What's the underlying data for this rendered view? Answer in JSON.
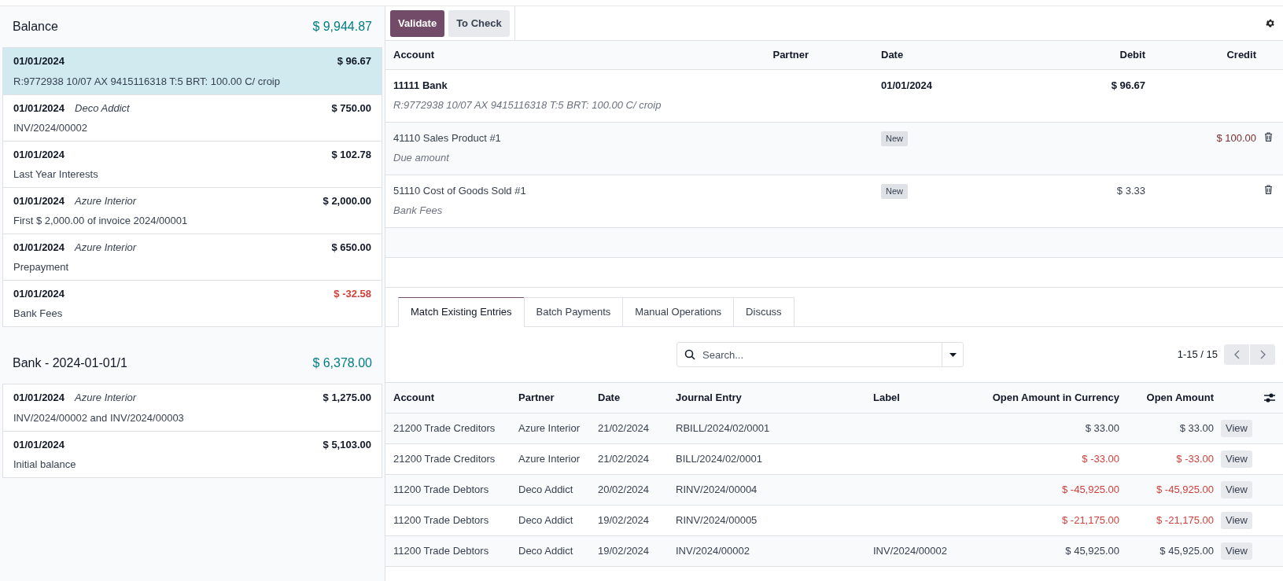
{
  "statements": [
    {
      "title": "Balance",
      "total": "$ 9,944.87",
      "lines": [
        {
          "date": "01/01/2024",
          "amount": "$ 96.67",
          "label": "R:9772938 10/07 AX 9415116318 T:5 BRT: 100.00 C/ croip",
          "negative": false,
          "selected": true
        },
        {
          "date": "01/01/2024",
          "partner": "Deco Addict",
          "amount": "$ 750.00",
          "label": "INV/2024/00002",
          "negative": false,
          "selected": false
        },
        {
          "date": "01/01/2024",
          "amount": "$ 102.78",
          "label": "Last Year Interests",
          "negative": false,
          "selected": false
        },
        {
          "date": "01/01/2024",
          "partner": "Azure Interior",
          "amount": "$ 2,000.00",
          "label": "First $ 2,000.00 of invoice 2024/00001",
          "negative": false,
          "selected": false
        },
        {
          "date": "01/01/2024",
          "partner": "Azure Interior",
          "amount": "$ 650.00",
          "label": "Prepayment",
          "negative": false,
          "selected": false
        },
        {
          "date": "01/01/2024",
          "amount": "$ -32.58",
          "label": "Bank Fees",
          "negative": true,
          "selected": false
        }
      ]
    },
    {
      "title": "Bank - 2024-01-01/1",
      "total": "$ 6,378.00",
      "lines": [
        {
          "date": "01/01/2024",
          "partner": "Azure Interior",
          "amount": "$ 1,275.00",
          "label": "INV/2024/00002 and INV/2024/00003",
          "negative": false,
          "selected": false
        },
        {
          "date": "01/01/2024",
          "amount": "$ 5,103.00",
          "label": "Initial balance",
          "negative": false,
          "selected": false
        }
      ]
    }
  ],
  "toolbar": [
    {
      "label": "Validate",
      "kind": "primary"
    },
    {
      "label": "To Check",
      "kind": "secondary"
    }
  ],
  "entry_table": {
    "columns": [
      "Account",
      "Partner",
      "Date",
      "Debit",
      "Credit"
    ],
    "rows": [
      {
        "kind": "bank",
        "account": "11111 Bank",
        "label": "R:9772938 10/07 AX 9415116318 T:5 BRT: 100.00 C/ croip",
        "date": "01/01/2024",
        "debit": "$ 96.67"
      },
      {
        "kind": "line",
        "account": "41110 Sales Product #1",
        "label": "Due amount",
        "badge": "New",
        "credit": "$ 100.00"
      },
      {
        "kind": "line",
        "account": "51110 Cost of Goods Sold #1",
        "label": "Bank Fees",
        "badge": "New",
        "debit": "$ 3.33"
      }
    ]
  },
  "tabs": [
    {
      "label": "Match Existing Entries",
      "selected": true
    },
    {
      "label": "Batch Payments",
      "selected": false
    },
    {
      "label": "Manual Operations",
      "selected": false
    },
    {
      "label": "Discuss",
      "selected": false
    }
  ],
  "search": {
    "placeholder": "Search..."
  },
  "pager": "1-15 / 15",
  "match_table": {
    "columns": [
      "Account",
      "Partner",
      "Date",
      "Journal Entry",
      "Label",
      "Open Amount in Currency",
      "Open Amount"
    ],
    "rows": [
      {
        "cells": [
          "21200 Trade Creditors",
          "Azure Interior",
          "21/02/2024",
          "RBILL/2024/02/0001",
          "",
          "$ 33.00",
          "$ 33.00"
        ],
        "negative": false,
        "action": "View"
      },
      {
        "cells": [
          "21200 Trade Creditors",
          "Azure Interior",
          "21/02/2024",
          "BILL/2024/02/0001",
          "",
          "$ -33.00",
          "$ -33.00"
        ],
        "negative": true,
        "action": "View"
      },
      {
        "cells": [
          "11200 Trade Debtors",
          "Deco Addict",
          "20/02/2024",
          "RINV/2024/00004",
          "",
          "$ -45,925.00",
          "$ -45,925.00"
        ],
        "negative": true,
        "action": "View"
      },
      {
        "cells": [
          "11200 Trade Debtors",
          "Deco Addict",
          "19/02/2024",
          "RINV/2024/00005",
          "",
          "$ -21,175.00",
          "$ -21,175.00"
        ],
        "negative": true,
        "action": "View"
      },
      {
        "cells": [
          "11200 Trade Debtors",
          "Deco Addict",
          "19/02/2024",
          "INV/2024/00002",
          "INV/2024/00002",
          "$ 45,925.00",
          "$ 45,925.00"
        ],
        "negative": false,
        "action": "View"
      }
    ]
  }
}
